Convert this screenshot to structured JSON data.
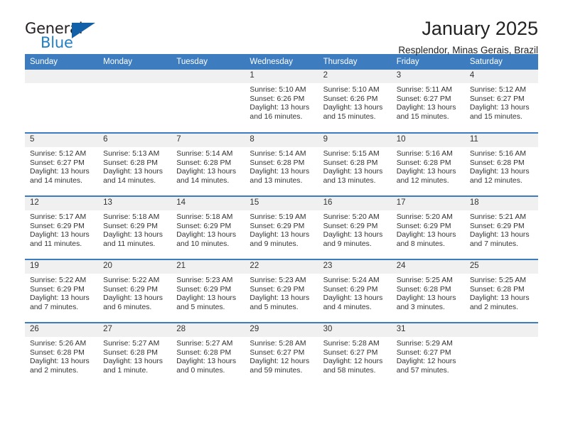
{
  "brand": {
    "name_part1": "General",
    "name_part2": "Blue",
    "logo_icon": "triangle-logo-icon"
  },
  "header": {
    "title": "January 2025",
    "subtitle": "Resplendor, Minas Gerais, Brazil"
  },
  "weekday_headers": [
    "Sunday",
    "Monday",
    "Tuesday",
    "Wednesday",
    "Thursday",
    "Friday",
    "Saturday"
  ],
  "colors": {
    "header_blue": "#3c7cbf",
    "daynum_band": "#f0f0f0",
    "brand_blue": "#1f7fc4",
    "logo_blue": "#1261a8",
    "text": "#333333"
  },
  "weeks": [
    [
      {
        "empty": true
      },
      {
        "empty": true
      },
      {
        "empty": true
      },
      {
        "day": "1",
        "sunrise": "Sunrise: 5:10 AM",
        "sunset": "Sunset: 6:26 PM",
        "daylight1": "Daylight: 13 hours",
        "daylight2": "and 16 minutes."
      },
      {
        "day": "2",
        "sunrise": "Sunrise: 5:10 AM",
        "sunset": "Sunset: 6:26 PM",
        "daylight1": "Daylight: 13 hours",
        "daylight2": "and 15 minutes."
      },
      {
        "day": "3",
        "sunrise": "Sunrise: 5:11 AM",
        "sunset": "Sunset: 6:27 PM",
        "daylight1": "Daylight: 13 hours",
        "daylight2": "and 15 minutes."
      },
      {
        "day": "4",
        "sunrise": "Sunrise: 5:12 AM",
        "sunset": "Sunset: 6:27 PM",
        "daylight1": "Daylight: 13 hours",
        "daylight2": "and 15 minutes."
      }
    ],
    [
      {
        "day": "5",
        "sunrise": "Sunrise: 5:12 AM",
        "sunset": "Sunset: 6:27 PM",
        "daylight1": "Daylight: 13 hours",
        "daylight2": "and 14 minutes."
      },
      {
        "day": "6",
        "sunrise": "Sunrise: 5:13 AM",
        "sunset": "Sunset: 6:28 PM",
        "daylight1": "Daylight: 13 hours",
        "daylight2": "and 14 minutes."
      },
      {
        "day": "7",
        "sunrise": "Sunrise: 5:14 AM",
        "sunset": "Sunset: 6:28 PM",
        "daylight1": "Daylight: 13 hours",
        "daylight2": "and 14 minutes."
      },
      {
        "day": "8",
        "sunrise": "Sunrise: 5:14 AM",
        "sunset": "Sunset: 6:28 PM",
        "daylight1": "Daylight: 13 hours",
        "daylight2": "and 13 minutes."
      },
      {
        "day": "9",
        "sunrise": "Sunrise: 5:15 AM",
        "sunset": "Sunset: 6:28 PM",
        "daylight1": "Daylight: 13 hours",
        "daylight2": "and 13 minutes."
      },
      {
        "day": "10",
        "sunrise": "Sunrise: 5:16 AM",
        "sunset": "Sunset: 6:28 PM",
        "daylight1": "Daylight: 13 hours",
        "daylight2": "and 12 minutes."
      },
      {
        "day": "11",
        "sunrise": "Sunrise: 5:16 AM",
        "sunset": "Sunset: 6:28 PM",
        "daylight1": "Daylight: 13 hours",
        "daylight2": "and 12 minutes."
      }
    ],
    [
      {
        "day": "12",
        "sunrise": "Sunrise: 5:17 AM",
        "sunset": "Sunset: 6:29 PM",
        "daylight1": "Daylight: 13 hours",
        "daylight2": "and 11 minutes."
      },
      {
        "day": "13",
        "sunrise": "Sunrise: 5:18 AM",
        "sunset": "Sunset: 6:29 PM",
        "daylight1": "Daylight: 13 hours",
        "daylight2": "and 11 minutes."
      },
      {
        "day": "14",
        "sunrise": "Sunrise: 5:18 AM",
        "sunset": "Sunset: 6:29 PM",
        "daylight1": "Daylight: 13 hours",
        "daylight2": "and 10 minutes."
      },
      {
        "day": "15",
        "sunrise": "Sunrise: 5:19 AM",
        "sunset": "Sunset: 6:29 PM",
        "daylight1": "Daylight: 13 hours",
        "daylight2": "and 9 minutes."
      },
      {
        "day": "16",
        "sunrise": "Sunrise: 5:20 AM",
        "sunset": "Sunset: 6:29 PM",
        "daylight1": "Daylight: 13 hours",
        "daylight2": "and 9 minutes."
      },
      {
        "day": "17",
        "sunrise": "Sunrise: 5:20 AM",
        "sunset": "Sunset: 6:29 PM",
        "daylight1": "Daylight: 13 hours",
        "daylight2": "and 8 minutes."
      },
      {
        "day": "18",
        "sunrise": "Sunrise: 5:21 AM",
        "sunset": "Sunset: 6:29 PM",
        "daylight1": "Daylight: 13 hours",
        "daylight2": "and 7 minutes."
      }
    ],
    [
      {
        "day": "19",
        "sunrise": "Sunrise: 5:22 AM",
        "sunset": "Sunset: 6:29 PM",
        "daylight1": "Daylight: 13 hours",
        "daylight2": "and 7 minutes."
      },
      {
        "day": "20",
        "sunrise": "Sunrise: 5:22 AM",
        "sunset": "Sunset: 6:29 PM",
        "daylight1": "Daylight: 13 hours",
        "daylight2": "and 6 minutes."
      },
      {
        "day": "21",
        "sunrise": "Sunrise: 5:23 AM",
        "sunset": "Sunset: 6:29 PM",
        "daylight1": "Daylight: 13 hours",
        "daylight2": "and 5 minutes."
      },
      {
        "day": "22",
        "sunrise": "Sunrise: 5:23 AM",
        "sunset": "Sunset: 6:29 PM",
        "daylight1": "Daylight: 13 hours",
        "daylight2": "and 5 minutes."
      },
      {
        "day": "23",
        "sunrise": "Sunrise: 5:24 AM",
        "sunset": "Sunset: 6:29 PM",
        "daylight1": "Daylight: 13 hours",
        "daylight2": "and 4 minutes."
      },
      {
        "day": "24",
        "sunrise": "Sunrise: 5:25 AM",
        "sunset": "Sunset: 6:28 PM",
        "daylight1": "Daylight: 13 hours",
        "daylight2": "and 3 minutes."
      },
      {
        "day": "25",
        "sunrise": "Sunrise: 5:25 AM",
        "sunset": "Sunset: 6:28 PM",
        "daylight1": "Daylight: 13 hours",
        "daylight2": "and 2 minutes."
      }
    ],
    [
      {
        "day": "26",
        "sunrise": "Sunrise: 5:26 AM",
        "sunset": "Sunset: 6:28 PM",
        "daylight1": "Daylight: 13 hours",
        "daylight2": "and 2 minutes."
      },
      {
        "day": "27",
        "sunrise": "Sunrise: 5:27 AM",
        "sunset": "Sunset: 6:28 PM",
        "daylight1": "Daylight: 13 hours",
        "daylight2": "and 1 minute."
      },
      {
        "day": "28",
        "sunrise": "Sunrise: 5:27 AM",
        "sunset": "Sunset: 6:28 PM",
        "daylight1": "Daylight: 13 hours",
        "daylight2": "and 0 minutes."
      },
      {
        "day": "29",
        "sunrise": "Sunrise: 5:28 AM",
        "sunset": "Sunset: 6:27 PM",
        "daylight1": "Daylight: 12 hours",
        "daylight2": "and 59 minutes."
      },
      {
        "day": "30",
        "sunrise": "Sunrise: 5:28 AM",
        "sunset": "Sunset: 6:27 PM",
        "daylight1": "Daylight: 12 hours",
        "daylight2": "and 58 minutes."
      },
      {
        "day": "31",
        "sunrise": "Sunrise: 5:29 AM",
        "sunset": "Sunset: 6:27 PM",
        "daylight1": "Daylight: 12 hours",
        "daylight2": "and 57 minutes."
      },
      {
        "empty": true
      }
    ]
  ]
}
